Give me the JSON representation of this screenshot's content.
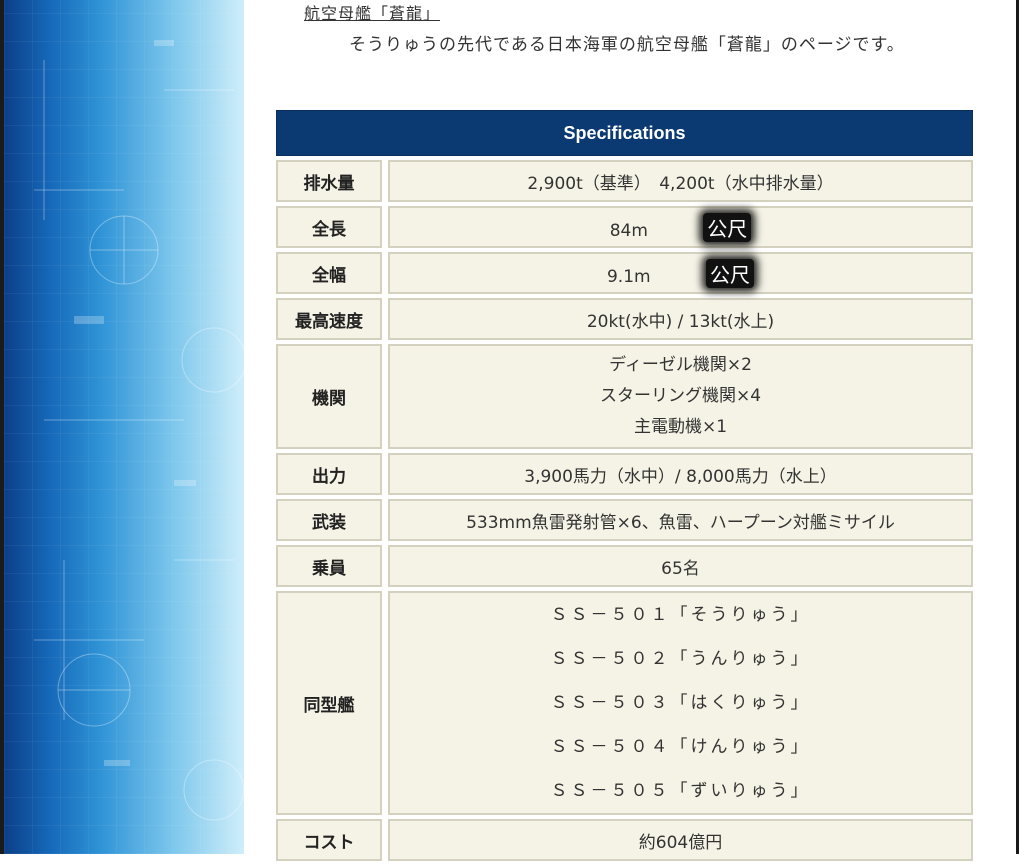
{
  "header": {
    "link_text": "航空母艦「蒼龍」",
    "description": "そうりゅうの先代である日本海軍の航空母艦「蒼龍」のページです。"
  },
  "table": {
    "title": "Specifications",
    "rows": [
      {
        "label": "排水量",
        "value": "2,900t（基準）　4,200t（水中排水量）"
      },
      {
        "label": "全長",
        "value": "84m",
        "badge": "公尺"
      },
      {
        "label": "全幅",
        "value": "9.1m",
        "badge": "公尺"
      },
      {
        "label": "最高速度",
        "value": "20kt(水中) / 13kt(水上)"
      },
      {
        "label": "機関",
        "lines": [
          "ディーゼル機関×2",
          "スターリング機関×4",
          "主電動機×1"
        ]
      },
      {
        "label": "出力",
        "value": "3,900馬力（水中）/ 8,000馬力（水上）"
      },
      {
        "label": "武装",
        "value": "533mm魚雷発射管×6、魚雷、ハープーン対艦ミサイル"
      },
      {
        "label": "乗員",
        "value": "65名"
      },
      {
        "label": "同型艦",
        "lines": [
          "ＳＳ－５０１「そうりゅう」",
          "ＳＳ－５０２「うんりゅう」",
          "ＳＳ－５０３「はくりゅう」",
          "ＳＳ－５０４「けんりゅう」",
          "ＳＳ－５０５「ずいりゅう」"
        ]
      },
      {
        "label": "コスト",
        "value": "約604億円"
      }
    ]
  }
}
